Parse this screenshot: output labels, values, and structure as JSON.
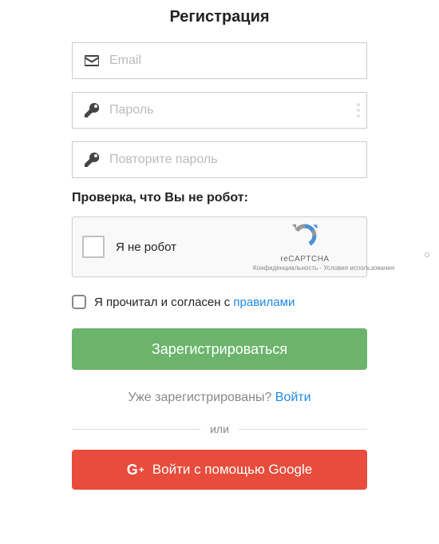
{
  "title": "Регистрация",
  "inputs": {
    "email": {
      "placeholder": "Email"
    },
    "password": {
      "placeholder": "Пароль"
    },
    "password_confirm": {
      "placeholder": "Повторите пароль"
    }
  },
  "robot_check": {
    "label": "Проверка, что Вы не робот:",
    "checkbox_label": "Я не робот",
    "brand": "reCAPTCHA",
    "privacy": "Конфиденциальность",
    "sep": " - ",
    "terms": "Условия использования"
  },
  "terms": {
    "text_prefix": "Я прочитал и согласен с ",
    "link_text": "правилами"
  },
  "buttons": {
    "register": "Зарегистрироваться",
    "google": "Войти с помощью Google"
  },
  "already": {
    "text": "Уже зарегистрированы? ",
    "link": "Войти"
  },
  "divider": {
    "text": "или"
  }
}
